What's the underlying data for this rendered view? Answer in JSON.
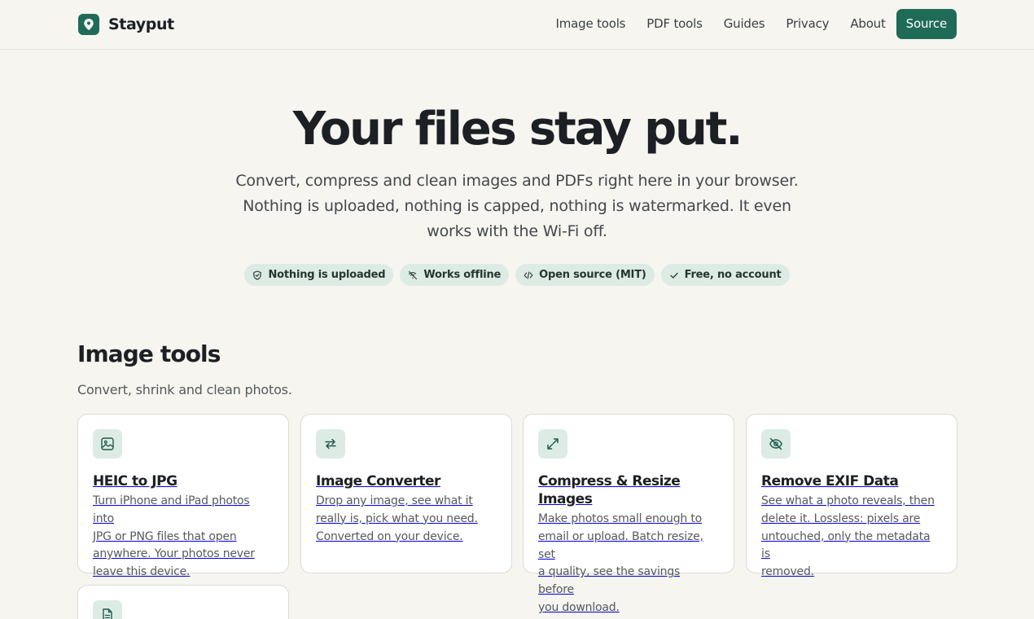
{
  "brand": {
    "name": "Stayput",
    "logo_icon": "map-pin-icon",
    "accent": "#1f6b58"
  },
  "nav": {
    "items": [
      {
        "label": "Image tools"
      },
      {
        "label": "PDF tools"
      },
      {
        "label": "Guides"
      },
      {
        "label": "Privacy"
      },
      {
        "label": "About"
      }
    ],
    "cta_label": "Source"
  },
  "hero": {
    "title": "Your files stay put.",
    "subtitle_lines": [
      "Convert, compress and clean images and PDFs right here in your browser.",
      "Nothing is uploaded, nothing is capped, nothing is watermarked. It even",
      "works with the Wi-Fi off."
    ],
    "pills": [
      {
        "label": "Nothing is uploaded",
        "icon": "shield-check-icon"
      },
      {
        "label": "Works offline",
        "icon": "wifi-off-icon"
      },
      {
        "label": "Open source (MIT)",
        "icon": "code-icon"
      },
      {
        "label": "Free, no account",
        "icon": "check-icon"
      }
    ]
  },
  "image_tools": {
    "title": "Image tools",
    "subtitle": "Convert, shrink and clean photos.",
    "cards": [
      {
        "title": "HEIC to JPG",
        "icon": "image-icon",
        "description_lines": [
          "Turn iPhone and iPad photos into",
          "JPG or PNG files that open",
          "anywhere. Your photos never",
          "leave this device."
        ]
      },
      {
        "title": "Image Converter",
        "icon": "swap-arrows-icon",
        "description_lines": [
          "Drop any image, see what it",
          "really is, pick what you need.",
          "Converted on your device."
        ]
      },
      {
        "title": "Compress & Resize Images",
        "icon": "expand-arrows-icon",
        "description_lines": [
          "Make photos small enough to",
          "email or upload. Batch resize, set",
          "a quality, see the savings before",
          "you download."
        ]
      },
      {
        "title": "Remove EXIF Data",
        "icon": "eye-off-icon",
        "description_lines": [
          "See what a photo reveals, then",
          "delete it. Lossless: pixels are",
          "untouched, only the metadata is",
          "removed."
        ]
      },
      {
        "title": "",
        "icon": "file-text-icon",
        "description_lines": []
      }
    ]
  }
}
